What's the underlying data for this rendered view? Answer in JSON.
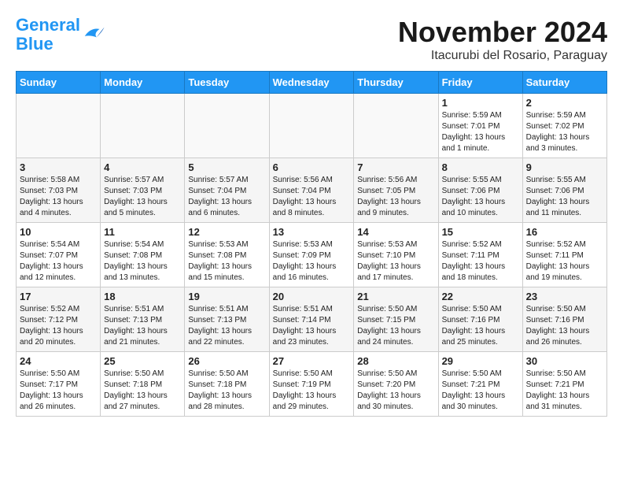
{
  "logo": {
    "line1": "General",
    "line2": "Blue"
  },
  "title": "November 2024",
  "subtitle": "Itacurubi del Rosario, Paraguay",
  "weekdays": [
    "Sunday",
    "Monday",
    "Tuesday",
    "Wednesday",
    "Thursday",
    "Friday",
    "Saturday"
  ],
  "weeks": [
    [
      {
        "day": "",
        "info": ""
      },
      {
        "day": "",
        "info": ""
      },
      {
        "day": "",
        "info": ""
      },
      {
        "day": "",
        "info": ""
      },
      {
        "day": "",
        "info": ""
      },
      {
        "day": "1",
        "info": "Sunrise: 5:59 AM\nSunset: 7:01 PM\nDaylight: 13 hours and 1 minute."
      },
      {
        "day": "2",
        "info": "Sunrise: 5:59 AM\nSunset: 7:02 PM\nDaylight: 13 hours and 3 minutes."
      }
    ],
    [
      {
        "day": "3",
        "info": "Sunrise: 5:58 AM\nSunset: 7:03 PM\nDaylight: 13 hours and 4 minutes."
      },
      {
        "day": "4",
        "info": "Sunrise: 5:57 AM\nSunset: 7:03 PM\nDaylight: 13 hours and 5 minutes."
      },
      {
        "day": "5",
        "info": "Sunrise: 5:57 AM\nSunset: 7:04 PM\nDaylight: 13 hours and 6 minutes."
      },
      {
        "day": "6",
        "info": "Sunrise: 5:56 AM\nSunset: 7:04 PM\nDaylight: 13 hours and 8 minutes."
      },
      {
        "day": "7",
        "info": "Sunrise: 5:56 AM\nSunset: 7:05 PM\nDaylight: 13 hours and 9 minutes."
      },
      {
        "day": "8",
        "info": "Sunrise: 5:55 AM\nSunset: 7:06 PM\nDaylight: 13 hours and 10 minutes."
      },
      {
        "day": "9",
        "info": "Sunrise: 5:55 AM\nSunset: 7:06 PM\nDaylight: 13 hours and 11 minutes."
      }
    ],
    [
      {
        "day": "10",
        "info": "Sunrise: 5:54 AM\nSunset: 7:07 PM\nDaylight: 13 hours and 12 minutes."
      },
      {
        "day": "11",
        "info": "Sunrise: 5:54 AM\nSunset: 7:08 PM\nDaylight: 13 hours and 13 minutes."
      },
      {
        "day": "12",
        "info": "Sunrise: 5:53 AM\nSunset: 7:08 PM\nDaylight: 13 hours and 15 minutes."
      },
      {
        "day": "13",
        "info": "Sunrise: 5:53 AM\nSunset: 7:09 PM\nDaylight: 13 hours and 16 minutes."
      },
      {
        "day": "14",
        "info": "Sunrise: 5:53 AM\nSunset: 7:10 PM\nDaylight: 13 hours and 17 minutes."
      },
      {
        "day": "15",
        "info": "Sunrise: 5:52 AM\nSunset: 7:11 PM\nDaylight: 13 hours and 18 minutes."
      },
      {
        "day": "16",
        "info": "Sunrise: 5:52 AM\nSunset: 7:11 PM\nDaylight: 13 hours and 19 minutes."
      }
    ],
    [
      {
        "day": "17",
        "info": "Sunrise: 5:52 AM\nSunset: 7:12 PM\nDaylight: 13 hours and 20 minutes."
      },
      {
        "day": "18",
        "info": "Sunrise: 5:51 AM\nSunset: 7:13 PM\nDaylight: 13 hours and 21 minutes."
      },
      {
        "day": "19",
        "info": "Sunrise: 5:51 AM\nSunset: 7:13 PM\nDaylight: 13 hours and 22 minutes."
      },
      {
        "day": "20",
        "info": "Sunrise: 5:51 AM\nSunset: 7:14 PM\nDaylight: 13 hours and 23 minutes."
      },
      {
        "day": "21",
        "info": "Sunrise: 5:50 AM\nSunset: 7:15 PM\nDaylight: 13 hours and 24 minutes."
      },
      {
        "day": "22",
        "info": "Sunrise: 5:50 AM\nSunset: 7:16 PM\nDaylight: 13 hours and 25 minutes."
      },
      {
        "day": "23",
        "info": "Sunrise: 5:50 AM\nSunset: 7:16 PM\nDaylight: 13 hours and 26 minutes."
      }
    ],
    [
      {
        "day": "24",
        "info": "Sunrise: 5:50 AM\nSunset: 7:17 PM\nDaylight: 13 hours and 26 minutes."
      },
      {
        "day": "25",
        "info": "Sunrise: 5:50 AM\nSunset: 7:18 PM\nDaylight: 13 hours and 27 minutes."
      },
      {
        "day": "26",
        "info": "Sunrise: 5:50 AM\nSunset: 7:18 PM\nDaylight: 13 hours and 28 minutes."
      },
      {
        "day": "27",
        "info": "Sunrise: 5:50 AM\nSunset: 7:19 PM\nDaylight: 13 hours and 29 minutes."
      },
      {
        "day": "28",
        "info": "Sunrise: 5:50 AM\nSunset: 7:20 PM\nDaylight: 13 hours and 30 minutes."
      },
      {
        "day": "29",
        "info": "Sunrise: 5:50 AM\nSunset: 7:21 PM\nDaylight: 13 hours and 30 minutes."
      },
      {
        "day": "30",
        "info": "Sunrise: 5:50 AM\nSunset: 7:21 PM\nDaylight: 13 hours and 31 minutes."
      }
    ]
  ]
}
